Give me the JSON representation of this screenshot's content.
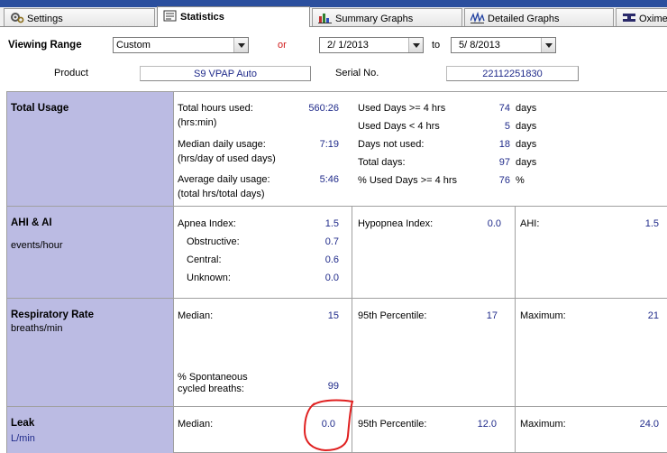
{
  "tabs": [
    {
      "label": "Settings",
      "icon": "settings-icon"
    },
    {
      "label": "Statistics",
      "icon": "statistics-icon"
    },
    {
      "label": "Summary Graphs",
      "icon": "bar-chart-icon"
    },
    {
      "label": "Detailed Graphs",
      "icon": "waveform-icon"
    },
    {
      "label": "Oxime",
      "icon": "oximetry-icon"
    }
  ],
  "range": {
    "label": "Viewing Range",
    "preset": "Custom",
    "or": "or",
    "start": "2/  1/2013",
    "to": "to",
    "end": "5/  8/2013"
  },
  "device": {
    "product_label": "Product",
    "product": "S9 VPAP Auto",
    "serial_label": "Serial No.",
    "serial": "22112251830"
  },
  "total_usage": {
    "title": "Total Usage",
    "hours_label1": "Total hours used:",
    "hours_label2": "(hrs:min)",
    "hours": "560:26",
    "median_label1": "Median daily usage:",
    "median_label2": "(hrs/day of used days)",
    "median": "7:19",
    "avg_label1": "Average daily usage:",
    "avg_label2": "(total hrs/total days)",
    "avg": "5:46",
    "days": [
      {
        "label": "Used Days >= 4 hrs",
        "value": "74",
        "unit": "days"
      },
      {
        "label": "Used Days < 4 hrs",
        "value": "5",
        "unit": "days"
      },
      {
        "label": "Days not used:",
        "value": "18",
        "unit": "days"
      },
      {
        "label": "Total days:",
        "value": "97",
        "unit": "days"
      },
      {
        "label": "% Used Days >= 4 hrs",
        "value": "76",
        "unit": "%"
      }
    ]
  },
  "ahi": {
    "title": "AHI & AI",
    "unit": "events/hour",
    "apnea_label": "Apnea Index:",
    "apnea": "1.5",
    "obstructive_label": "Obstructive:",
    "obstructive": "0.7",
    "central_label": "Central:",
    "central": "0.6",
    "unknown_label": "Unknown:",
    "unknown": "0.0",
    "hypopnea_label": "Hypopnea Index:",
    "hypopnea": "0.0",
    "ahi_label": "AHI:",
    "ahi": "1.5"
  },
  "resp": {
    "title": "Respiratory Rate",
    "unit": "breaths/min",
    "median_label": "Median:",
    "median": "15",
    "p95_label": "95th Percentile:",
    "p95": "17",
    "max_label": "Maximum:",
    "max": "21",
    "spont_label1": "% Spontaneous",
    "spont_label2": "cycled breaths:",
    "spont": "99"
  },
  "leak": {
    "title": "Leak",
    "unit": "L/min",
    "median_label": "Median:",
    "median": "0.0",
    "p95_label": "95th Percentile:",
    "p95": "12.0",
    "max_label": "Maximum:",
    "max": "24.0"
  },
  "annotation_color": "#e02020"
}
